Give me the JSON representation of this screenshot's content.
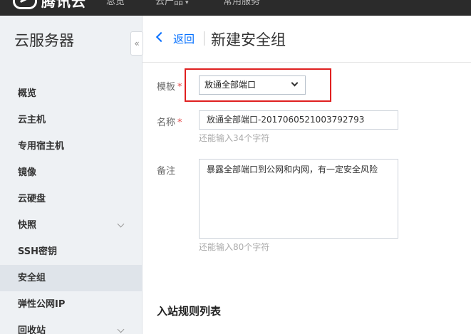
{
  "topbar": {
    "brand": "腾讯云",
    "nav": [
      {
        "label": "总览"
      },
      {
        "label": "云产品"
      },
      {
        "label": "常用服务"
      }
    ]
  },
  "sidebar": {
    "title": "云服务器",
    "collapse_glyph": "«",
    "items": [
      {
        "label": "概览"
      },
      {
        "label": "云主机"
      },
      {
        "label": "专用宿主机"
      },
      {
        "label": "镜像"
      },
      {
        "label": "云硬盘"
      },
      {
        "label": "快照"
      },
      {
        "label": "SSH密钥"
      },
      {
        "label": "安全组"
      },
      {
        "label": "弹性公网IP"
      },
      {
        "label": "回收站"
      }
    ],
    "active_item": "安全组"
  },
  "header": {
    "back_label": "返回",
    "title": "新建安全组"
  },
  "form": {
    "template": {
      "label": "模板",
      "required_mark": "*",
      "value": "放通全部端口"
    },
    "name": {
      "label": "名称",
      "required_mark": "*",
      "value": "放通全部端口-2017060521003792793",
      "hint": "还能输入34个字符"
    },
    "remark": {
      "label": "备注",
      "value": "暴露全部端口到公网和内网，有一定安全风险",
      "hint": "还能输入80个字符"
    }
  },
  "inbound": {
    "title": "入站规则列表"
  },
  "colors": {
    "topbar_bg": "#2b2b2b",
    "sidebar_bg": "#eef1f4",
    "active_item_bg": "#dfe4ea",
    "link": "#006eff",
    "required": "#e54545",
    "highlight_box": "#e02020"
  }
}
